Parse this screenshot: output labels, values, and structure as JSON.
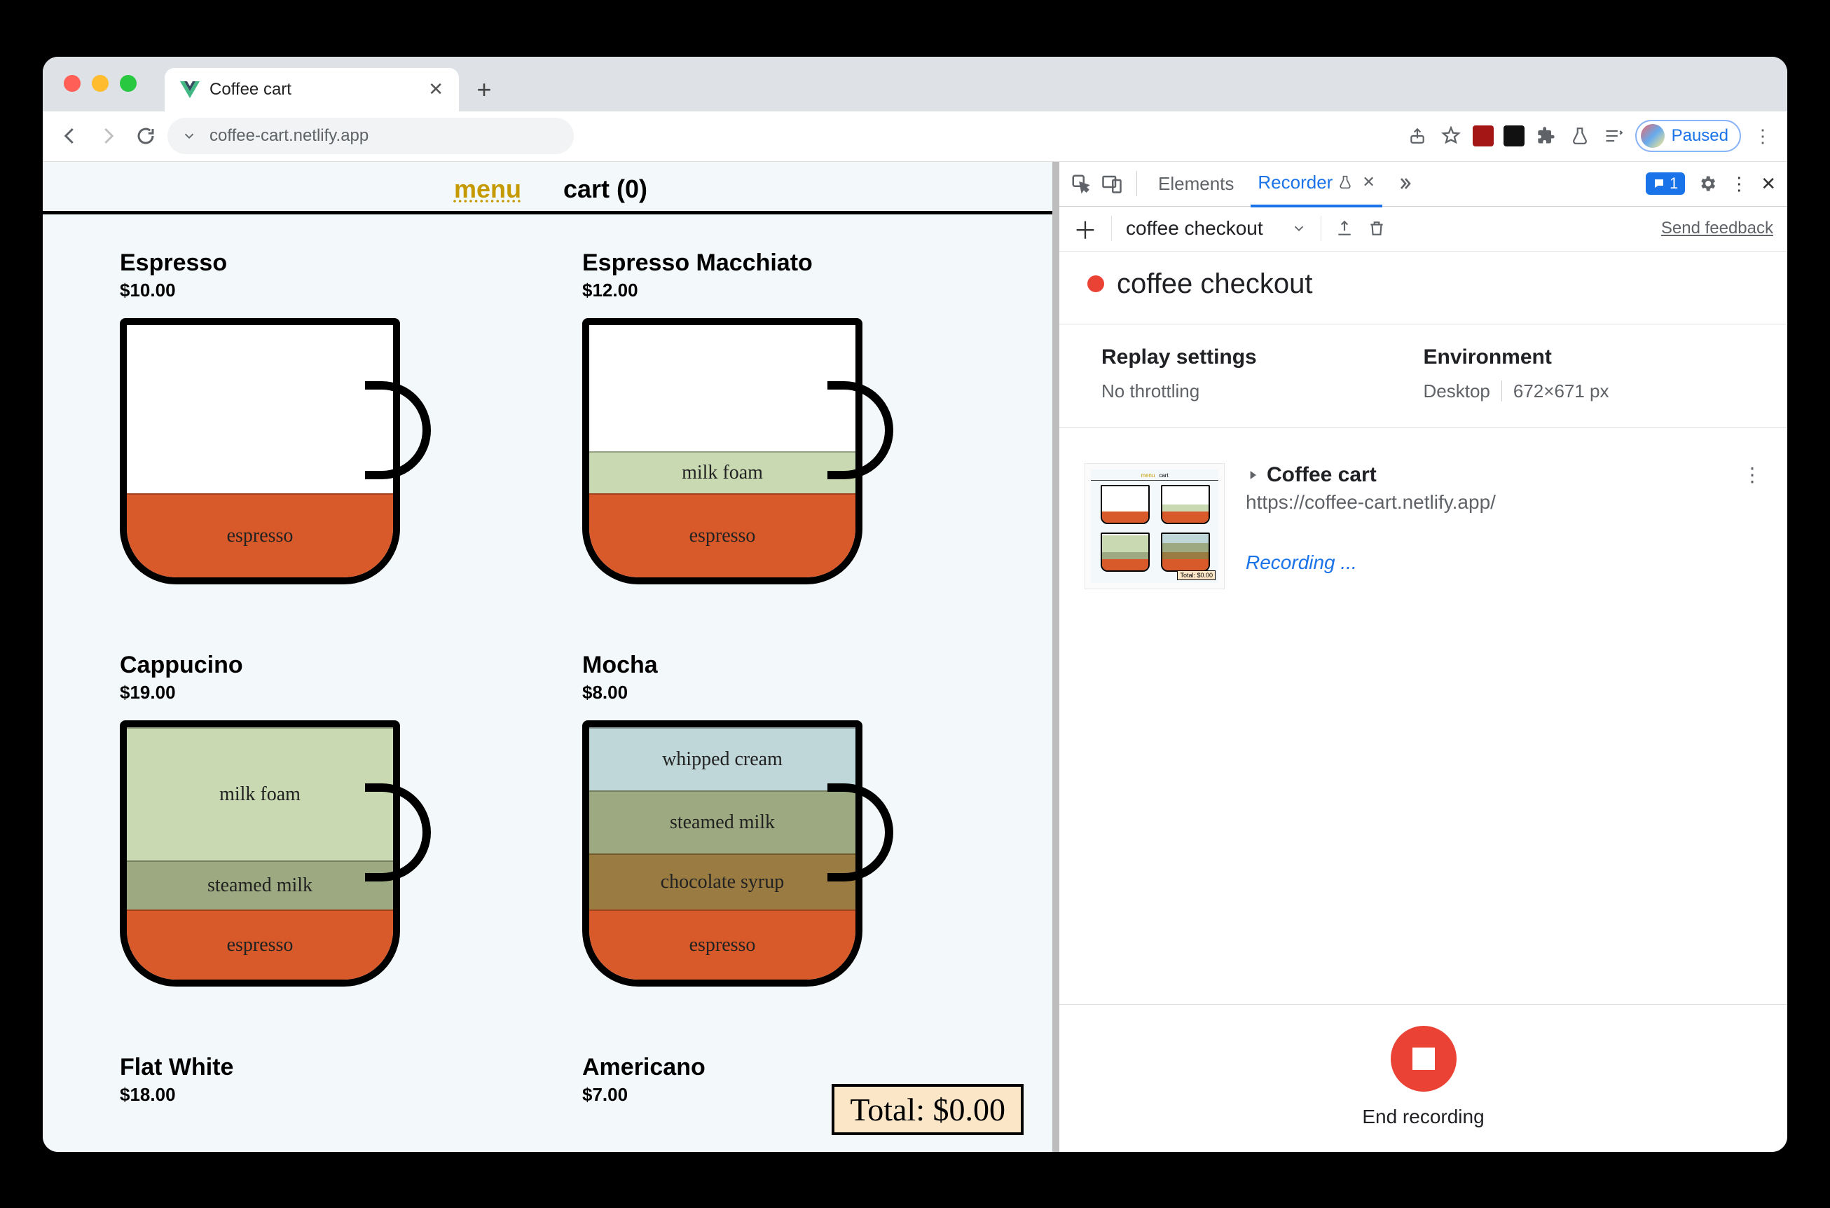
{
  "browser": {
    "tab_title": "Coffee cart",
    "url_display": "coffee-cart.netlify.app",
    "profile_status": "Paused"
  },
  "page": {
    "nav": {
      "menu": "menu",
      "cart": "cart (0)"
    },
    "drinks": [
      {
        "name": "Espresso",
        "price": "$10.00",
        "layers": [
          {
            "label": "espresso",
            "cls": "l-espresso",
            "h": 120
          }
        ]
      },
      {
        "name": "Espresso Macchiato",
        "price": "$12.00",
        "layers": [
          {
            "label": "milk foam",
            "cls": "l-milkfoam",
            "h": 60
          },
          {
            "label": "espresso",
            "cls": "l-espresso",
            "h": 120
          }
        ]
      },
      {
        "name": "Cappucino",
        "price": "$19.00",
        "layers": [
          {
            "label": "milk foam",
            "cls": "l-milkfoam",
            "h": 190
          },
          {
            "label": "steamed milk",
            "cls": "l-steamed",
            "h": 70
          },
          {
            "label": "espresso",
            "cls": "l-espresso",
            "h": 100
          }
        ]
      },
      {
        "name": "Mocha",
        "price": "$8.00",
        "layers": [
          {
            "label": "whipped cream",
            "cls": "l-whipped",
            "h": 90
          },
          {
            "label": "steamed milk",
            "cls": "l-steamed",
            "h": 90
          },
          {
            "label": "chocolate syrup",
            "cls": "l-chocolate",
            "h": 80
          },
          {
            "label": "espresso",
            "cls": "l-espresso",
            "h": 100
          }
        ]
      },
      {
        "name": "Flat White",
        "price": "$18.00",
        "layers": []
      },
      {
        "name": "Americano",
        "price": "$7.00",
        "layers": []
      }
    ],
    "total_label": "Total: $0.00"
  },
  "devtools": {
    "tabs": {
      "elements": "Elements",
      "recorder": "Recorder"
    },
    "issues_count": "1",
    "toolbar": {
      "recording_name": "coffee checkout",
      "feedback": "Send feedback"
    },
    "recording_title": "coffee checkout",
    "settings": {
      "replay_title": "Replay settings",
      "replay_value": "No throttling",
      "env_title": "Environment",
      "env_device": "Desktop",
      "env_size": "672×671 px"
    },
    "step": {
      "title": "Coffee cart",
      "url": "https://coffee-cart.netlify.app/",
      "status": "Recording ..."
    },
    "footer_label": "End recording"
  }
}
